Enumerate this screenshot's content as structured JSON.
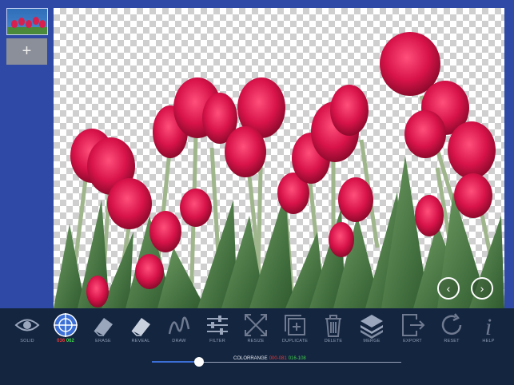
{
  "layers": {
    "add_label": "+"
  },
  "toolbar": {
    "tools": [
      {
        "name": "solid-tool",
        "label": "SOLID"
      },
      {
        "name": "target-tool",
        "label": ""
      },
      {
        "name": "erase-tool",
        "label": "ERASE"
      },
      {
        "name": "reveal-tool",
        "label": "REVEAL"
      },
      {
        "name": "draw-tool",
        "label": "DRAW"
      },
      {
        "name": "filter-tool",
        "label": "FILTER"
      },
      {
        "name": "resize-tool",
        "label": "RESIZE"
      },
      {
        "name": "duplicate-tool",
        "label": "DUPLICATE"
      },
      {
        "name": "delete-tool",
        "label": "DELETE"
      },
      {
        "name": "merge-tool",
        "label": "MERGE"
      },
      {
        "name": "export-tool",
        "label": "EXPORT"
      },
      {
        "name": "reset-tool",
        "label": "RESET"
      },
      {
        "name": "help-tool",
        "label": "HELP"
      }
    ],
    "target_counts": {
      "red": "036",
      "green": "062"
    }
  },
  "color_range": {
    "label": "COLORRANGE",
    "red": "000-081",
    "green": "016-108",
    "blue": "",
    "slider_fraction": 0.19
  },
  "colors": {
    "accent": "#3b6fd6",
    "red": "#e53a3a",
    "green": "#3fcf4a",
    "blue": "#3a62e5"
  }
}
